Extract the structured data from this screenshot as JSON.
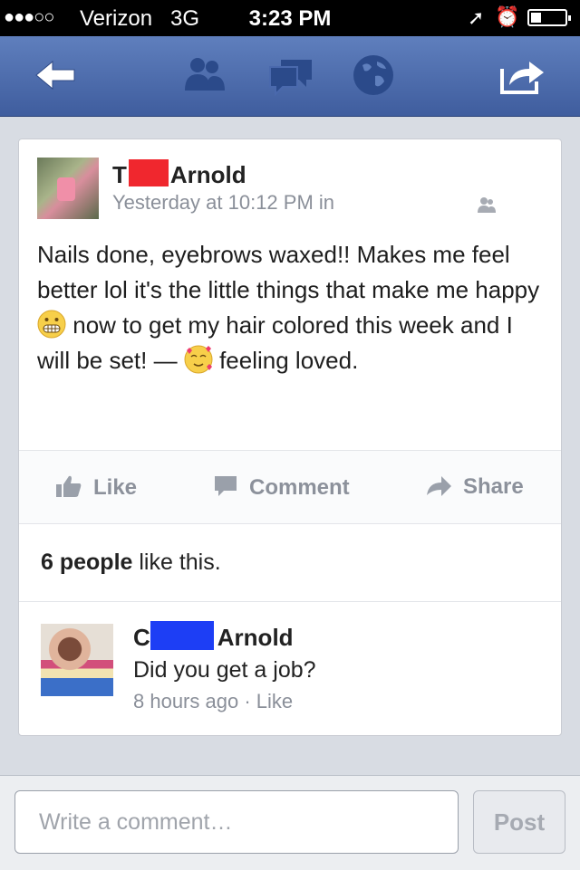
{
  "status_bar": {
    "signal_dots": "●●●○○",
    "carrier": "Verizon",
    "network": "3G",
    "time": "3:23 PM"
  },
  "nav": {
    "icons": [
      "back-arrow-icon",
      "friends-icon",
      "messages-icon",
      "globe-icon",
      "share-icon"
    ]
  },
  "post": {
    "author_first_initial": "T",
    "author_last": "Arnold",
    "timestamp": "Yesterday at 10:12 PM in",
    "text_part1": "Nails done, eyebrows waxed!! Makes me feel better lol it's the little things that make me happy",
    "text_part2": "now to get my hair colored this week and I will be set! —",
    "text_part3": "feeling loved.",
    "actions": {
      "like": "Like",
      "comment": "Comment",
      "share": "Share"
    },
    "likes_count": "6 people",
    "likes_suffix": "like this."
  },
  "comment": {
    "author_first_initial": "C",
    "author_last": "Arnold",
    "text": "Did you get a job?",
    "time": "8 hours ago",
    "separator": "·",
    "like": "Like"
  },
  "composer": {
    "placeholder": "Write a comment…",
    "post_label": "Post"
  },
  "colors": {
    "nav_blue": "#4a69ad",
    "redaction_red": "#f0272e",
    "redaction_blue": "#1d3ef5"
  }
}
